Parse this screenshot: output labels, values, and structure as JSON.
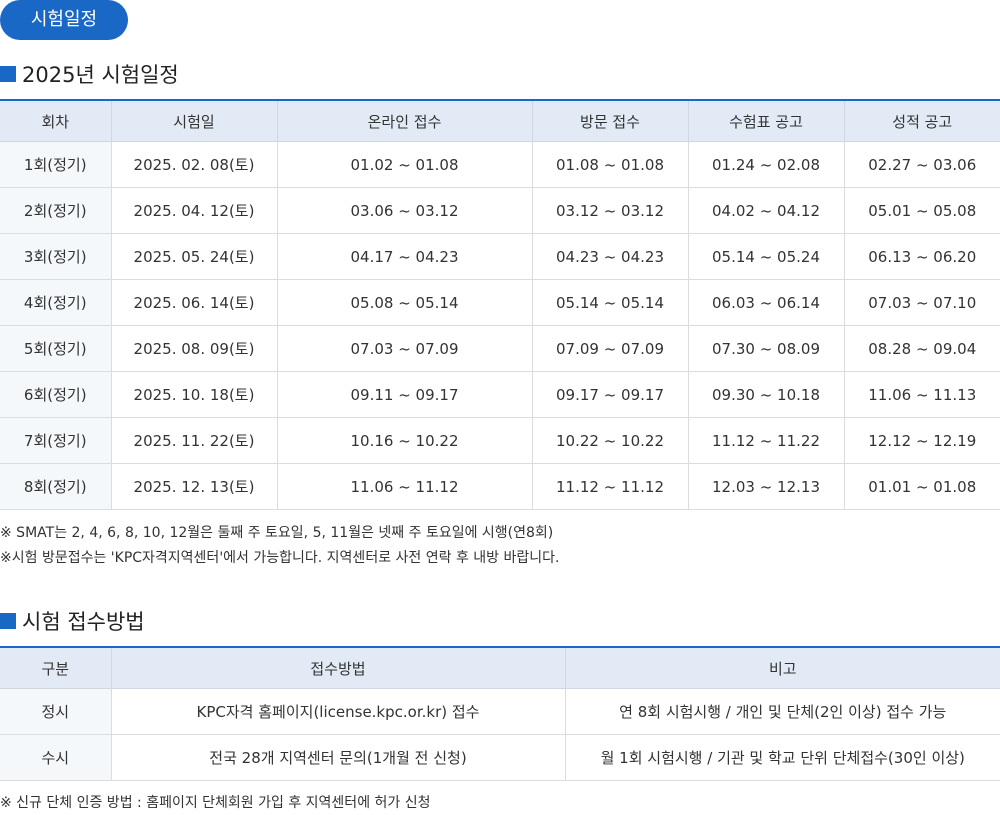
{
  "badge": "시험일정",
  "schedule": {
    "title": "2025년 시험일정",
    "headers": [
      "회차",
      "시험일",
      "온라인 접수",
      "방문 접수",
      "수험표 공고",
      "성적 공고"
    ],
    "rows": [
      [
        "1회(정기)",
        "2025. 02. 08(토)",
        "01.02 ~ 01.08",
        "01.08 ~ 01.08",
        "01.24 ~ 02.08",
        "02.27 ~ 03.06"
      ],
      [
        "2회(정기)",
        "2025. 04. 12(토)",
        "03.06 ~ 03.12",
        "03.12 ~ 03.12",
        "04.02 ~ 04.12",
        "05.01 ~ 05.08"
      ],
      [
        "3회(정기)",
        "2025. 05. 24(토)",
        "04.17 ~ 04.23",
        "04.23 ~ 04.23",
        "05.14 ~ 05.24",
        "06.13 ~ 06.20"
      ],
      [
        "4회(정기)",
        "2025. 06. 14(토)",
        "05.08 ~ 05.14",
        "05.14 ~ 05.14",
        "06.03 ~ 06.14",
        "07.03 ~ 07.10"
      ],
      [
        "5회(정기)",
        "2025. 08. 09(토)",
        "07.03 ~ 07.09",
        "07.09 ~ 07.09",
        "07.30 ~ 08.09",
        "08.28 ~ 09.04"
      ],
      [
        "6회(정기)",
        "2025. 10. 18(토)",
        "09.11 ~ 09.17",
        "09.17 ~ 09.17",
        "09.30 ~ 10.18",
        "11.06 ~ 11.13"
      ],
      [
        "7회(정기)",
        "2025. 11. 22(토)",
        "10.16 ~ 10.22",
        "10.22 ~ 10.22",
        "11.12 ~ 11.22",
        "12.12 ~ 12.19"
      ],
      [
        "8회(정기)",
        "2025. 12. 13(토)",
        "11.06 ~ 11.12",
        "11.12 ~ 11.12",
        "12.03 ~ 12.13",
        "01.01 ~ 01.08"
      ]
    ],
    "notes": [
      "※ SMAT는 2, 4, 6, 8, 10, 12월은 둘째 주 토요일, 5, 11월은 넷째 주 토요일에 시행(연8회)",
      "※시험 방문접수는 'KPC자격지역센터'에서 가능합니다. 지역센터로 사전 연락 후 내방 바랍니다."
    ]
  },
  "method": {
    "title": "시험 접수방법",
    "headers": [
      "구분",
      "접수방법",
      "비고"
    ],
    "rows": [
      [
        "정시",
        "KPC자격 홈페이지(license.kpc.or.kr) 접수",
        "연 8회 시험시행 / 개인 및 단체(2인 이상) 접수 가능"
      ],
      [
        "수시",
        "전국 28개 지역센터 문의(1개월 전 신청)",
        "월 1회 시험시행 / 기관 및 학교 단위 단체접수(30인 이상)"
      ]
    ],
    "note": "※ 신규 단체 인증 방법 : 홈페이지 단체회원 가입 후 지역센터에 허가 신청"
  }
}
